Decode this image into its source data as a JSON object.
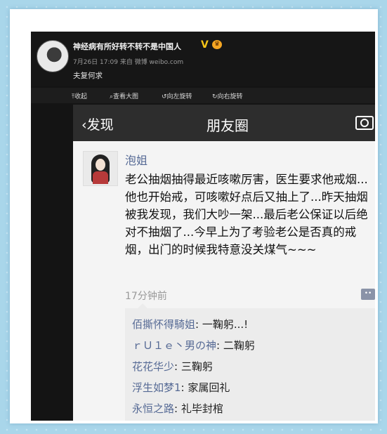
{
  "weibo": {
    "username": "神经病有所好转不转不是中国人",
    "badge_v": "V",
    "meta": "7月26日 17:09 来自 微博 weibo.com",
    "post_text": "夫复何求"
  },
  "toolbar": {
    "collapse": "收起",
    "view_large": "查看大图",
    "rotate_left": "向左旋转",
    "rotate_right": "向右旋转"
  },
  "moments": {
    "back_label": "发现",
    "title": "朋友圈",
    "poster_name": "泡姐",
    "post_text": "老公抽烟抽得最近咳嗽厉害，医生要求他戒烟...他也开始戒，可咳嗽好点后又抽上了...昨天抽烟被我发现，我们大吵一架...最后老公保证以后绝对不抽烟了...今早上为了考验老公是否真的戒烟，出门的时候我特意没关煤气~~~",
    "time": "17分钟前",
    "comments": [
      {
        "user": "佰撕怀得騎姐",
        "text": "一鞠躬...!"
      },
      {
        "user": "ｒＵ１ｅ丶男の神",
        "text": "二鞠躬"
      },
      {
        "user": "花花华少",
        "text": "三鞠躬"
      },
      {
        "user": "浮生如梦1",
        "text": "家属回礼"
      },
      {
        "user": "永恒之路",
        "text": "礼毕封棺"
      }
    ]
  }
}
